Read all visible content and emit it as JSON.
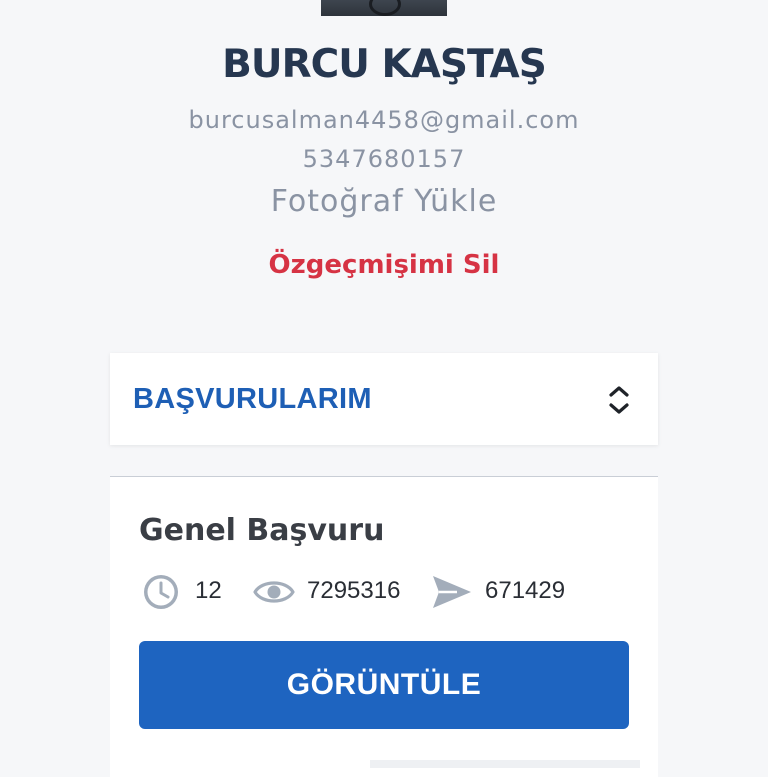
{
  "profile": {
    "name": "BURCU KAŞTAŞ",
    "email": "burcusalman4458@gmail.com",
    "phone": "5347680157",
    "upload_photo_label": "Fotoğraf Yükle",
    "delete_cv_label": "Özgeçmişimi Sil"
  },
  "applications": {
    "section_title": "BAŞVURULARIM",
    "toggle_icon": "chevron-up-down-icon",
    "items": [
      {
        "title": "Genel Başvuru",
        "stats": {
          "days": "12",
          "views": "7295316",
          "applications": "671429"
        },
        "button_label": "GÖRÜNTÜLE"
      }
    ]
  },
  "colors": {
    "background": "#f6f7f9",
    "name": "#263750",
    "muted": "#8a93a3",
    "danger": "#d63344",
    "accent": "#1e64c0"
  }
}
